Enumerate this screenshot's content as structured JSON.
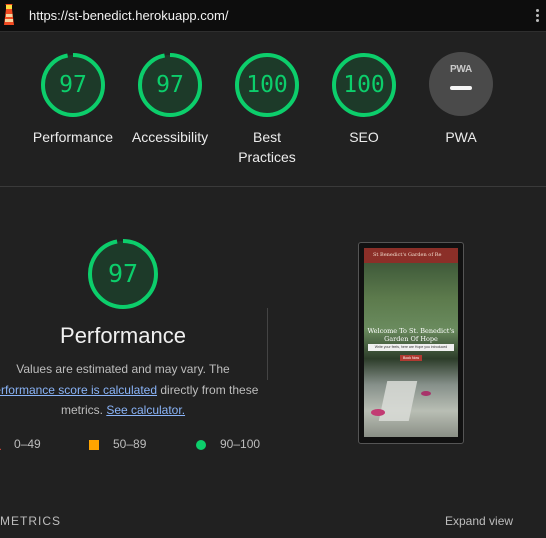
{
  "browser": {
    "url": "https://st-benedict.herokuapp.com/",
    "icons": {
      "app": "lighthouse-icon",
      "menu": "more-vert-icon"
    }
  },
  "summary_gauges": [
    {
      "score": "97",
      "label": "Performance"
    },
    {
      "score": "97",
      "label": "Accessibility"
    },
    {
      "score": "100",
      "label": "Best Practices"
    },
    {
      "score": "100",
      "label": "SEO"
    }
  ],
  "pwa": {
    "badge_text": "PWA",
    "label": "PWA"
  },
  "performance": {
    "score": "97",
    "title": "Performance",
    "desc_1": "Values are estimated and may vary. The",
    "desc_link_1": "performance score is calculated",
    "desc_2": " directly from these",
    "desc_3": "metrics. ",
    "desc_link_2": "See calculator."
  },
  "legend": [
    {
      "range": "0–49",
      "shape": "triangle",
      "color": "#ff4e42"
    },
    {
      "range": "50–89",
      "shape": "square",
      "color": "#ffa400"
    },
    {
      "range": "90–100",
      "shape": "circle",
      "color": "#0cce6b"
    }
  ],
  "screenshot_thumb": {
    "header_text": "St Benedict's Garden of Re",
    "hero_title_1": "Welcome To St. Benedict's",
    "hero_title_2": "Garden Of Hope",
    "search_placeholder": "Write your feels, here are Hope you introduced",
    "button": "Book Now"
  },
  "footer": {
    "metrics_label": "METRICS",
    "expand_label": "Expand view"
  },
  "colors": {
    "pass": "#0cce6b",
    "background": "#212121",
    "link": "#8ab4f8"
  }
}
